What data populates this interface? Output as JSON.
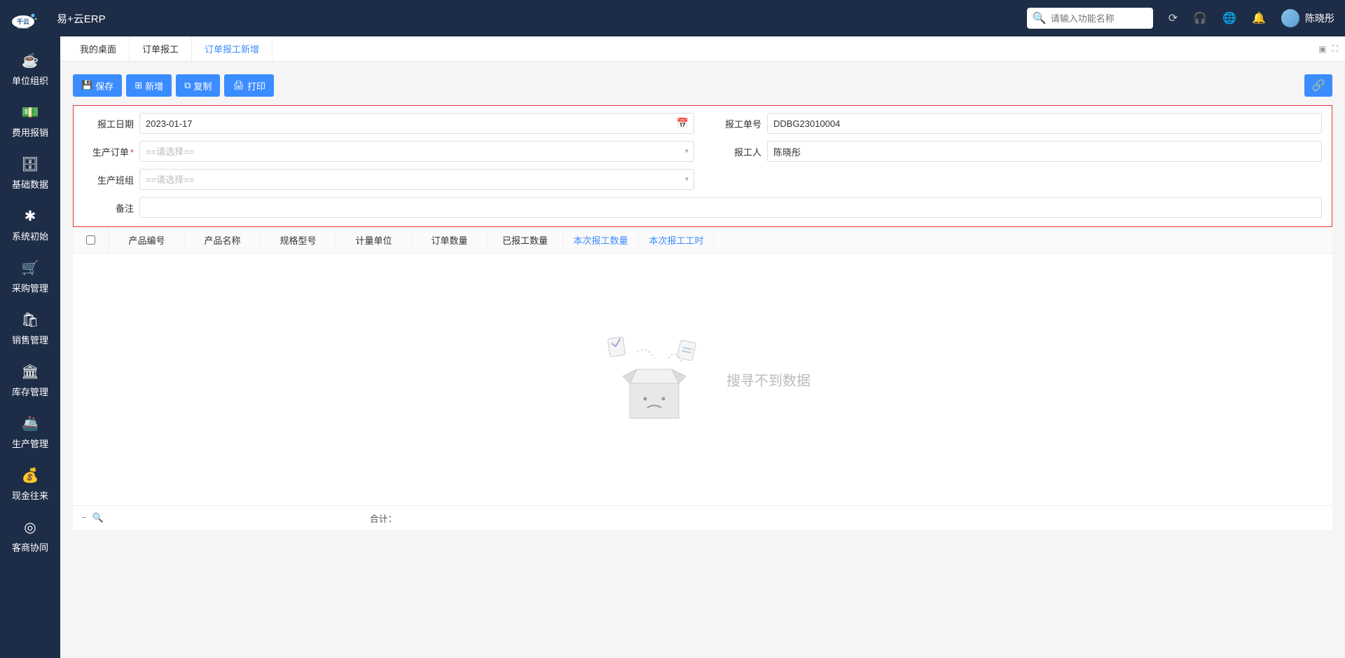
{
  "header": {
    "app_name": "易+云ERP",
    "search_placeholder": "请输入功能名称",
    "username": "陈晓彤"
  },
  "sidebar": {
    "items": [
      {
        "icon": "☕",
        "label": "单位组织"
      },
      {
        "icon": "💵",
        "label": "费用报销"
      },
      {
        "icon": "🗄",
        "label": "基础数据"
      },
      {
        "icon": "✱",
        "label": "系统初始"
      },
      {
        "icon": "🛒",
        "label": "采购管理"
      },
      {
        "icon": "🛍",
        "label": "销售管理"
      },
      {
        "icon": "🏛",
        "label": "库存管理"
      },
      {
        "icon": "🚢",
        "label": "生产管理"
      },
      {
        "icon": "💰",
        "label": "现金往来"
      },
      {
        "icon": "◎",
        "label": "客商协同"
      }
    ]
  },
  "tabs": {
    "items": [
      {
        "label": "我的桌面"
      },
      {
        "label": "订单报工"
      },
      {
        "label": "订单报工新增"
      }
    ],
    "active": 2
  },
  "toolbar": {
    "save": "保存",
    "new": "新增",
    "copy": "复制",
    "print": "打印"
  },
  "form": {
    "date_label": "报工日期",
    "date_value": "2023-01-17",
    "doc_no_label": "报工单号",
    "doc_no_value": "DDBG23010004",
    "order_label": "生产订单",
    "order_placeholder": "==请选择==",
    "reporter_label": "报工人",
    "reporter_value": "陈晓彤",
    "team_label": "生产班组",
    "team_placeholder": "==请选择==",
    "remark_label": "备注"
  },
  "table": {
    "columns": [
      "产品编号",
      "产品名称",
      "规格型号",
      "计量单位",
      "订单数量",
      "已报工数量",
      "本次报工数量",
      "本次报工工时"
    ],
    "highlight_cols": [
      6,
      7
    ],
    "empty_text": "搜寻不到数据",
    "footer_sum_label": "合计："
  }
}
